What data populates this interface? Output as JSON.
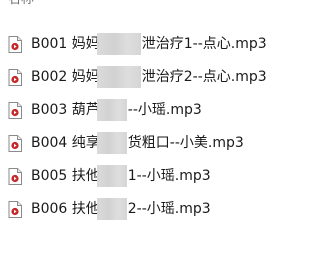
{
  "column_header": {
    "name_label": "名称"
  },
  "files": [
    {
      "name": "B001 妈妈　　　泄治疗1--点心.mp3",
      "icon": "audio-file-icon"
    },
    {
      "name": "B002 妈妈　　　泄治疗2--点心.mp3",
      "icon": "audio-file-icon"
    },
    {
      "name": "B003 葫芦　　--小瑶.mp3",
      "icon": "audio-file-icon"
    },
    {
      "name": "B004 纯享　　货粗口--小美.mp3",
      "icon": "audio-file-icon"
    },
    {
      "name": "B005 扶他　　1--小瑶.mp3",
      "icon": "audio-file-icon"
    },
    {
      "name": "B006 扶他　　2--小瑶.mp3",
      "icon": "audio-file-icon"
    }
  ]
}
